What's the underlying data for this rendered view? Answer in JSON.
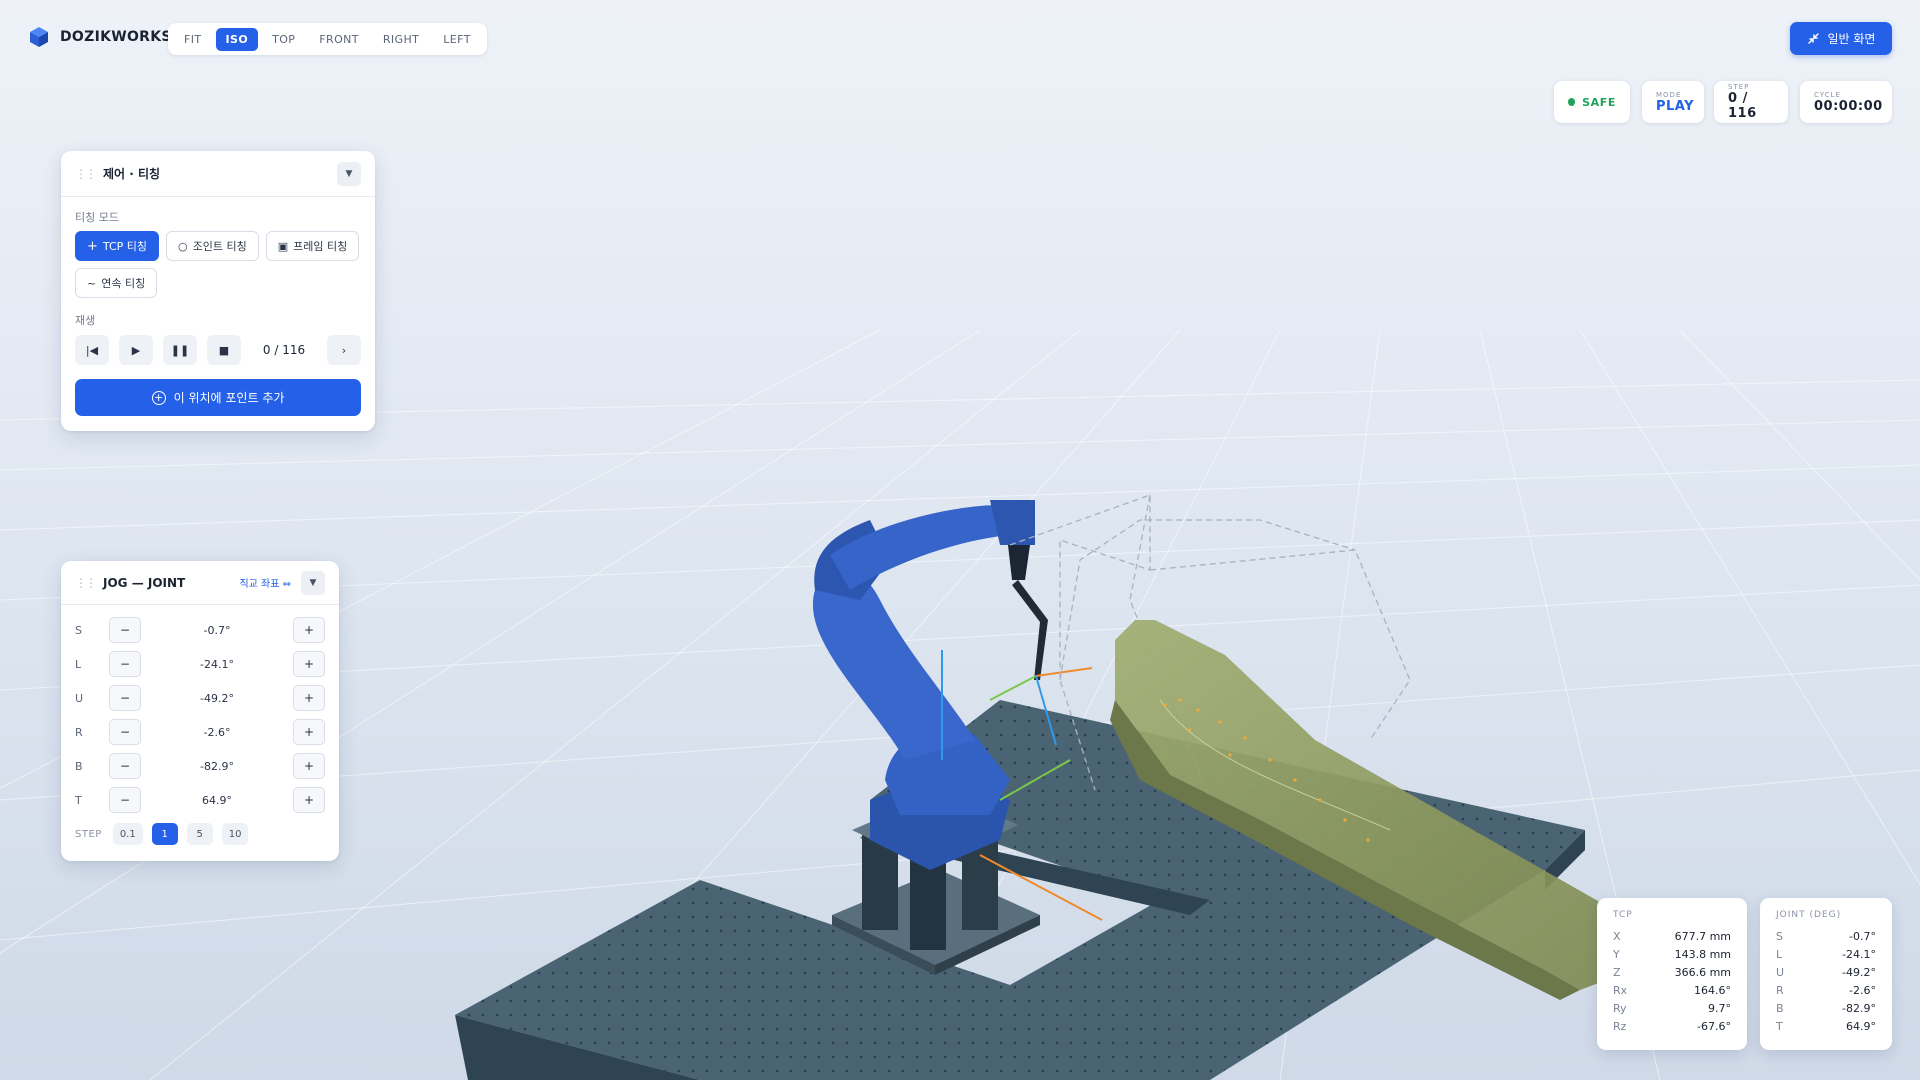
{
  "brand": {
    "name": "DOZIKWORKS"
  },
  "view_tabs": [
    {
      "label": "FIT",
      "active": false
    },
    {
      "label": "ISO",
      "active": true
    },
    {
      "label": "TOP",
      "active": false
    },
    {
      "label": "FRONT",
      "active": false
    },
    {
      "label": "RIGHT",
      "active": false
    },
    {
      "label": "LEFT",
      "active": false
    }
  ],
  "normal_view_button": {
    "label": "일반 화면",
    "icon": "collapse-arrows-icon"
  },
  "status": {
    "safe": "SAFE",
    "mode_label": "MODE",
    "mode_value": "PLAY",
    "step_label": "STEP",
    "step_value": "0 / 116",
    "cycle_label": "CYCLE",
    "cycle_value": "00:00:00"
  },
  "colors": {
    "accent": "#2460e8",
    "safe": "#1fa35a",
    "robot": "#2e5bb8",
    "table": "#46606f",
    "part": "#8d9a5c"
  },
  "control_panel": {
    "title": "제어 · 티칭",
    "teach_mode_label": "티칭 모드",
    "teach_modes": [
      {
        "label": "TCP 티칭",
        "icon": "plus-icon",
        "active": true
      },
      {
        "label": "조인트 티칭",
        "icon": "circle-icon",
        "active": false
      },
      {
        "label": "프레임 티칭",
        "icon": "frame-icon",
        "active": false
      },
      {
        "label": "연속 티칭",
        "icon": "wave-icon",
        "active": false
      }
    ],
    "playback_label": "재생",
    "playback_counter": "0 / 116",
    "add_point_label": "이 위치에 포인트 추가"
  },
  "jog_panel": {
    "title": "JOG — JOINT",
    "coord_toggle": "직교 좌표",
    "axes": [
      {
        "axis": "S",
        "value": "-0.7°"
      },
      {
        "axis": "L",
        "value": "-24.1°"
      },
      {
        "axis": "U",
        "value": "-49.2°"
      },
      {
        "axis": "R",
        "value": "-2.6°"
      },
      {
        "axis": "B",
        "value": "-82.9°"
      },
      {
        "axis": "T",
        "value": "64.9°"
      }
    ],
    "step_label": "STEP",
    "steps": [
      {
        "label": "0.1",
        "active": false
      },
      {
        "label": "1",
        "active": true
      },
      {
        "label": "5",
        "active": false
      },
      {
        "label": "10",
        "active": false
      }
    ]
  },
  "tcp_readout": {
    "title": "TCP",
    "rows": [
      {
        "k": "X",
        "v": "677.7 mm"
      },
      {
        "k": "Y",
        "v": "143.8 mm"
      },
      {
        "k": "Z",
        "v": "366.6 mm"
      },
      {
        "k": "Rx",
        "v": "164.6°"
      },
      {
        "k": "Ry",
        "v": "9.7°"
      },
      {
        "k": "Rz",
        "v": "-67.6°"
      }
    ]
  },
  "joint_readout": {
    "title": "JOINT (DEG)",
    "rows": [
      {
        "k": "S",
        "v": "-0.7°"
      },
      {
        "k": "L",
        "v": "-24.1°"
      },
      {
        "k": "U",
        "v": "-49.2°"
      },
      {
        "k": "R",
        "v": "-2.6°"
      },
      {
        "k": "B",
        "v": "-82.9°"
      },
      {
        "k": "T",
        "v": "64.9°"
      }
    ]
  }
}
